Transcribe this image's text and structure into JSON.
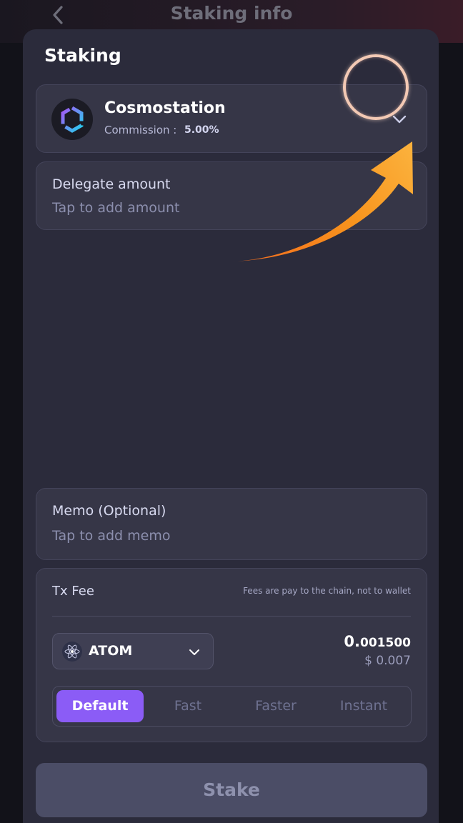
{
  "header": {
    "title": "Staking info"
  },
  "sheet": {
    "title": "Staking"
  },
  "validator": {
    "name": "Cosmostation",
    "commission_label": "Commission :",
    "commission_value": "5.00%"
  },
  "delegate": {
    "label": "Delegate amount",
    "placeholder": "Tap to add amount"
  },
  "memo": {
    "label": "Memo (Optional)",
    "placeholder": "Tap to add memo"
  },
  "fee": {
    "title": "Tx Fee",
    "note": "Fees are pay to the chain, not to wallet",
    "token": "ATOM",
    "amount_int": "0.",
    "amount_dec": "001500",
    "usd_symbol": "$",
    "usd_int": "0.",
    "usd_dec": "007",
    "speeds": [
      "Default",
      "Fast",
      "Faster",
      "Instant"
    ],
    "selected_speed": "Default"
  },
  "action": {
    "stake_label": "Stake"
  },
  "colors": {
    "accent": "#8b5cf6",
    "arrow": "#f7941d",
    "sheet_bg": "#2b2b3b"
  }
}
